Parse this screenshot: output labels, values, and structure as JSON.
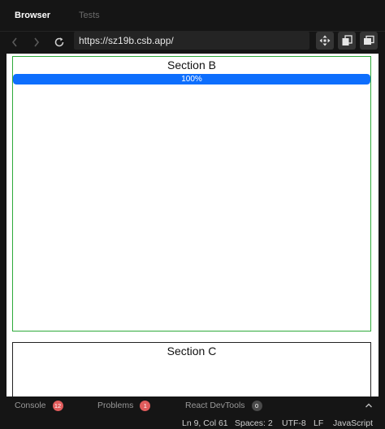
{
  "tabs": [
    {
      "label": "Browser",
      "active": true
    },
    {
      "label": "Tests",
      "active": false
    }
  ],
  "toolbar": {
    "url": "https://sz19b.csb.app/",
    "back_icon": "chevron-left-icon",
    "forward_icon": "chevron-right-icon",
    "refresh_icon": "refresh-icon",
    "tools": [
      "move-icon",
      "copy-icon",
      "window-icon"
    ]
  },
  "preview": {
    "section_b": {
      "title": "Section B",
      "progress_label": "100%",
      "progress_value": 100,
      "border_color": "#2eaa3a"
    },
    "section_c": {
      "title": "Section C"
    },
    "progress_color": "#0d6efd"
  },
  "panel": {
    "tabs": [
      {
        "label": "Console",
        "count": "12",
        "badge_color": "#e05c5c"
      },
      {
        "label": "Problems",
        "count": "1",
        "badge_color": "#e05c5c"
      },
      {
        "label": "React DevTools",
        "count": "0",
        "badge_color": "#4a4a4a"
      }
    ],
    "collapse_icon": "chevron-up-icon"
  },
  "status": {
    "position": "Ln 9, Col 61",
    "spaces": "Spaces: 2",
    "encoding": "UTF-8",
    "eol": "LF",
    "language": "JavaScript"
  }
}
